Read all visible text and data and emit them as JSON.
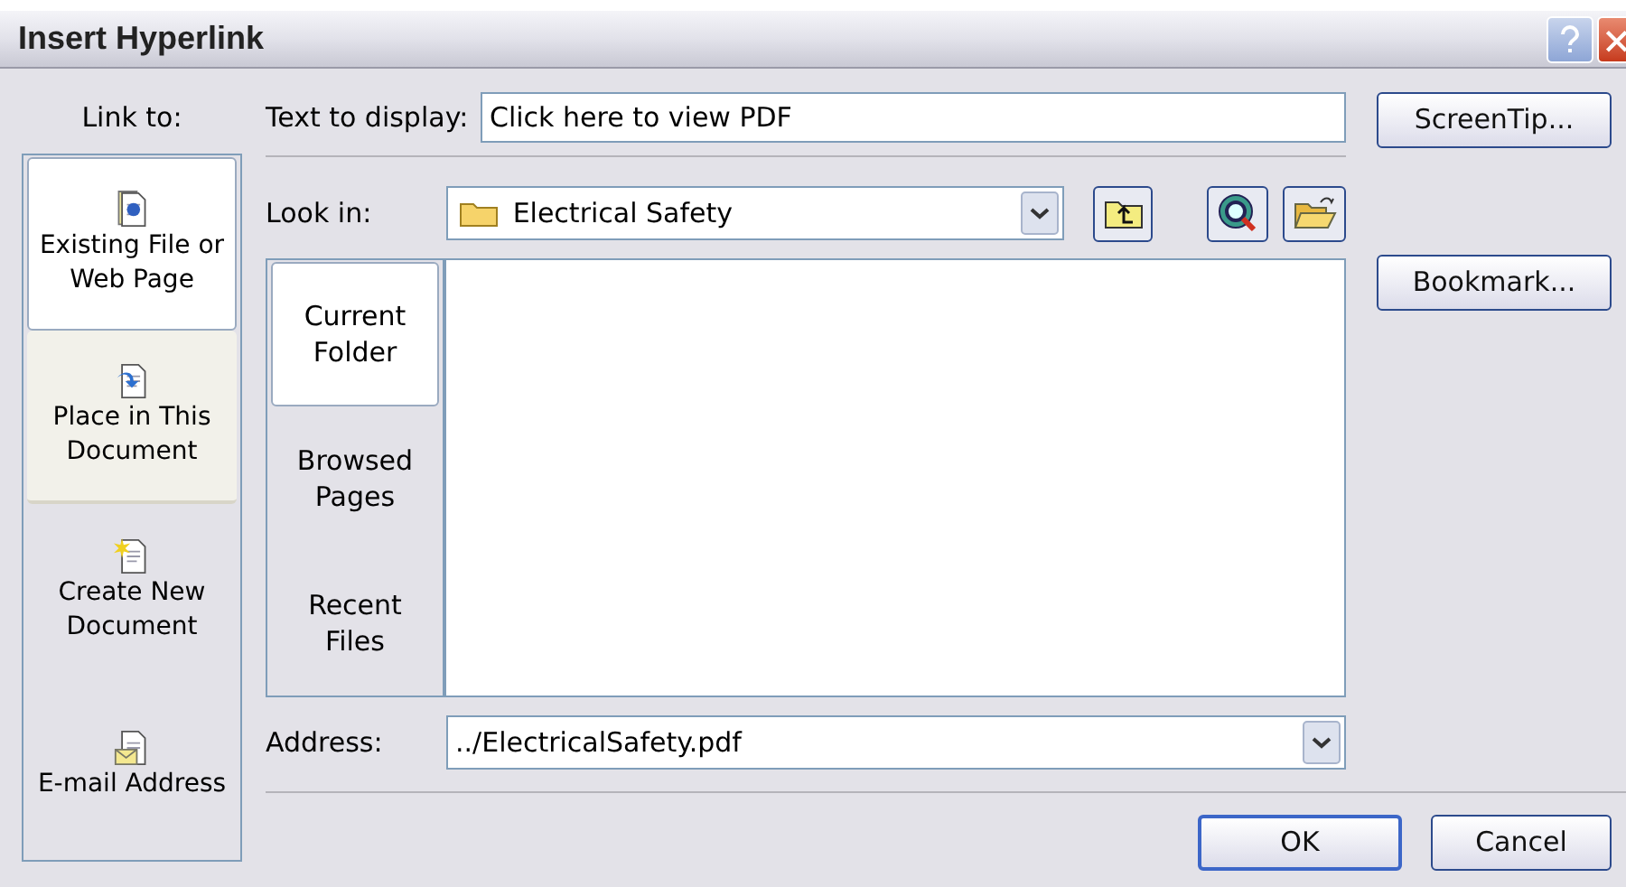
{
  "window": {
    "title": "Insert Hyperlink"
  },
  "link_to": {
    "label": "Link to:",
    "items": [
      {
        "kind": "file",
        "label": "Existing File or Web Page",
        "selected": true,
        "hovered": false
      },
      {
        "kind": "place",
        "label": "Place in This Document",
        "selected": false,
        "hovered": true
      },
      {
        "kind": "new",
        "label": "Create New Document",
        "selected": false,
        "hovered": false
      },
      {
        "kind": "email",
        "label": "E-mail Address",
        "selected": false,
        "hovered": false
      }
    ]
  },
  "text_to_display": {
    "label": "Text to display:",
    "value": "Click here to view PDF"
  },
  "look_in": {
    "label": "Look in:",
    "value": "Electrical Safety"
  },
  "places": [
    {
      "label": "Current Folder",
      "selected": true
    },
    {
      "label": "Browsed Pages",
      "selected": false
    },
    {
      "label": "Recent Files",
      "selected": false
    }
  ],
  "address": {
    "label": "Address:",
    "value": "../ElectricalSafety.pdf"
  },
  "side_buttons": [
    {
      "label": "ScreenTip..."
    },
    {
      "label": "Bookmark..."
    }
  ],
  "footer_buttons": [
    {
      "label": "OK",
      "default": true
    },
    {
      "label": "Cancel",
      "default": false
    }
  ]
}
